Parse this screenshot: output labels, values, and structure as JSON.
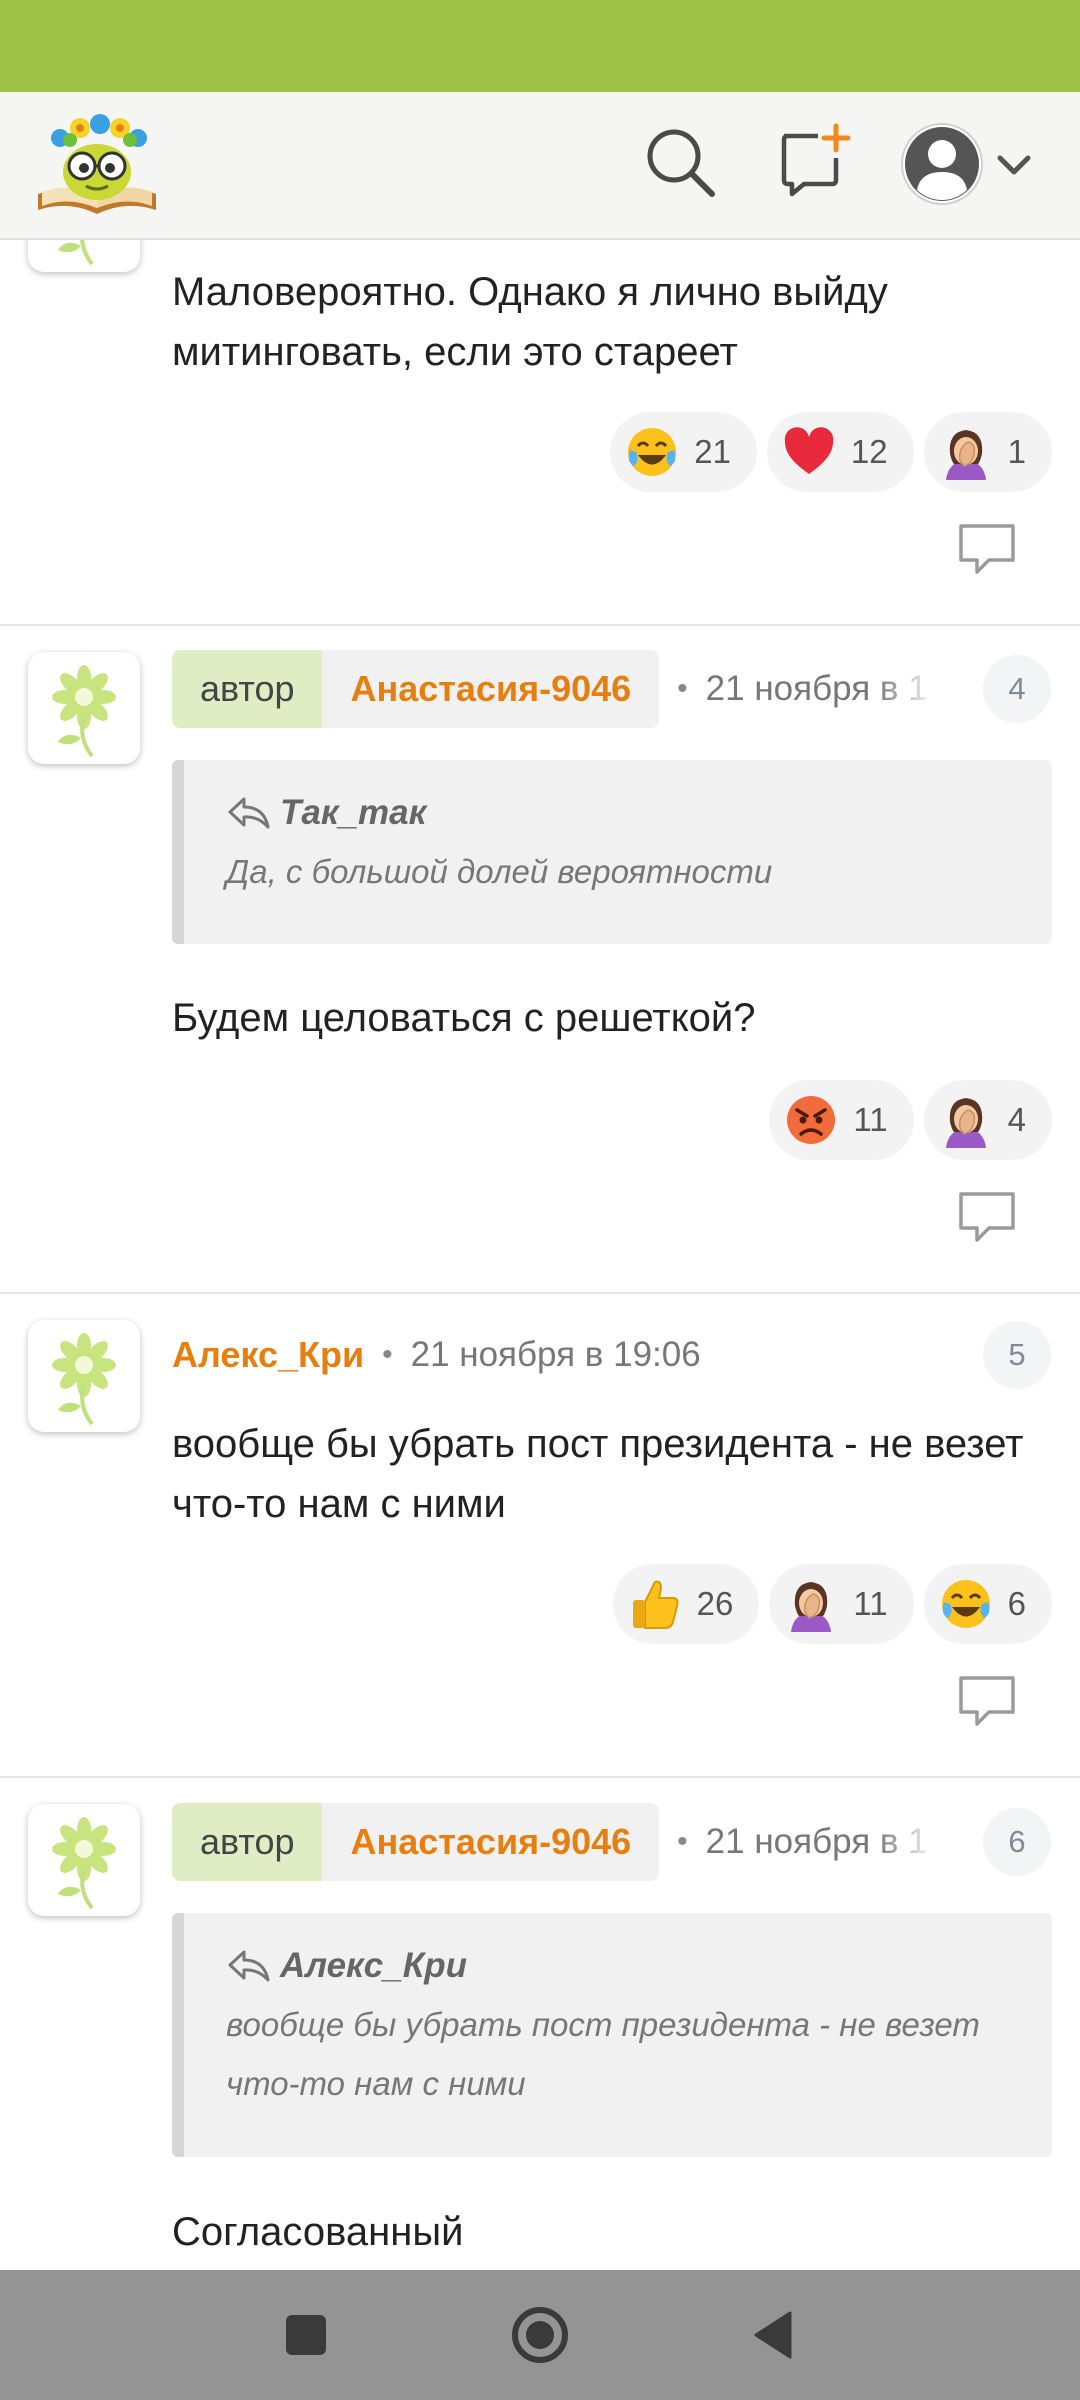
{
  "comments": [
    {
      "text": "Маловероятно. Однако я лично выйду митинговать, если это стареет",
      "reactions": [
        {
          "icon": "tears-of-joy-emoji",
          "count": "21"
        },
        {
          "icon": "red-heart-emoji",
          "count": "12"
        },
        {
          "icon": "facepalm-emoji",
          "count": "1"
        }
      ]
    },
    {
      "author_tag": "автор",
      "username": "Анастасия-9046",
      "date": "21 ноября в 1",
      "number": "4",
      "quote_author": "Так_так",
      "quote_text": "Да, с большой долей вероятности",
      "text": "Будем целоваться с решеткой?",
      "reactions": [
        {
          "icon": "angry-face-emoji",
          "count": "11"
        },
        {
          "icon": "facepalm-emoji",
          "count": "4"
        }
      ]
    },
    {
      "username": "Алекс_Кри",
      "date": "21 ноября в 19:06",
      "number": "5",
      "text": "вообще бы убрать пост президента - не везет что-то нам с ними",
      "reactions": [
        {
          "icon": "thumbs-up-emoji",
          "count": "26"
        },
        {
          "icon": "facepalm-emoji",
          "count": "11"
        },
        {
          "icon": "tears-of-joy-emoji",
          "count": "6"
        }
      ]
    },
    {
      "author_tag": "автор",
      "username": "Анастасия-9046",
      "date": "21 ноября в 1",
      "number": "6",
      "quote_author": "Алекс_Кри",
      "quote_text": "вообще бы убрать пост президента - не везет что-то нам с ними",
      "text": "Согласованный"
    }
  ],
  "colors": {
    "status_bar": "#9dc245",
    "username": "#e87e0e",
    "author_tag_bg": "#e0edc4",
    "nav_bar": "#949494"
  }
}
